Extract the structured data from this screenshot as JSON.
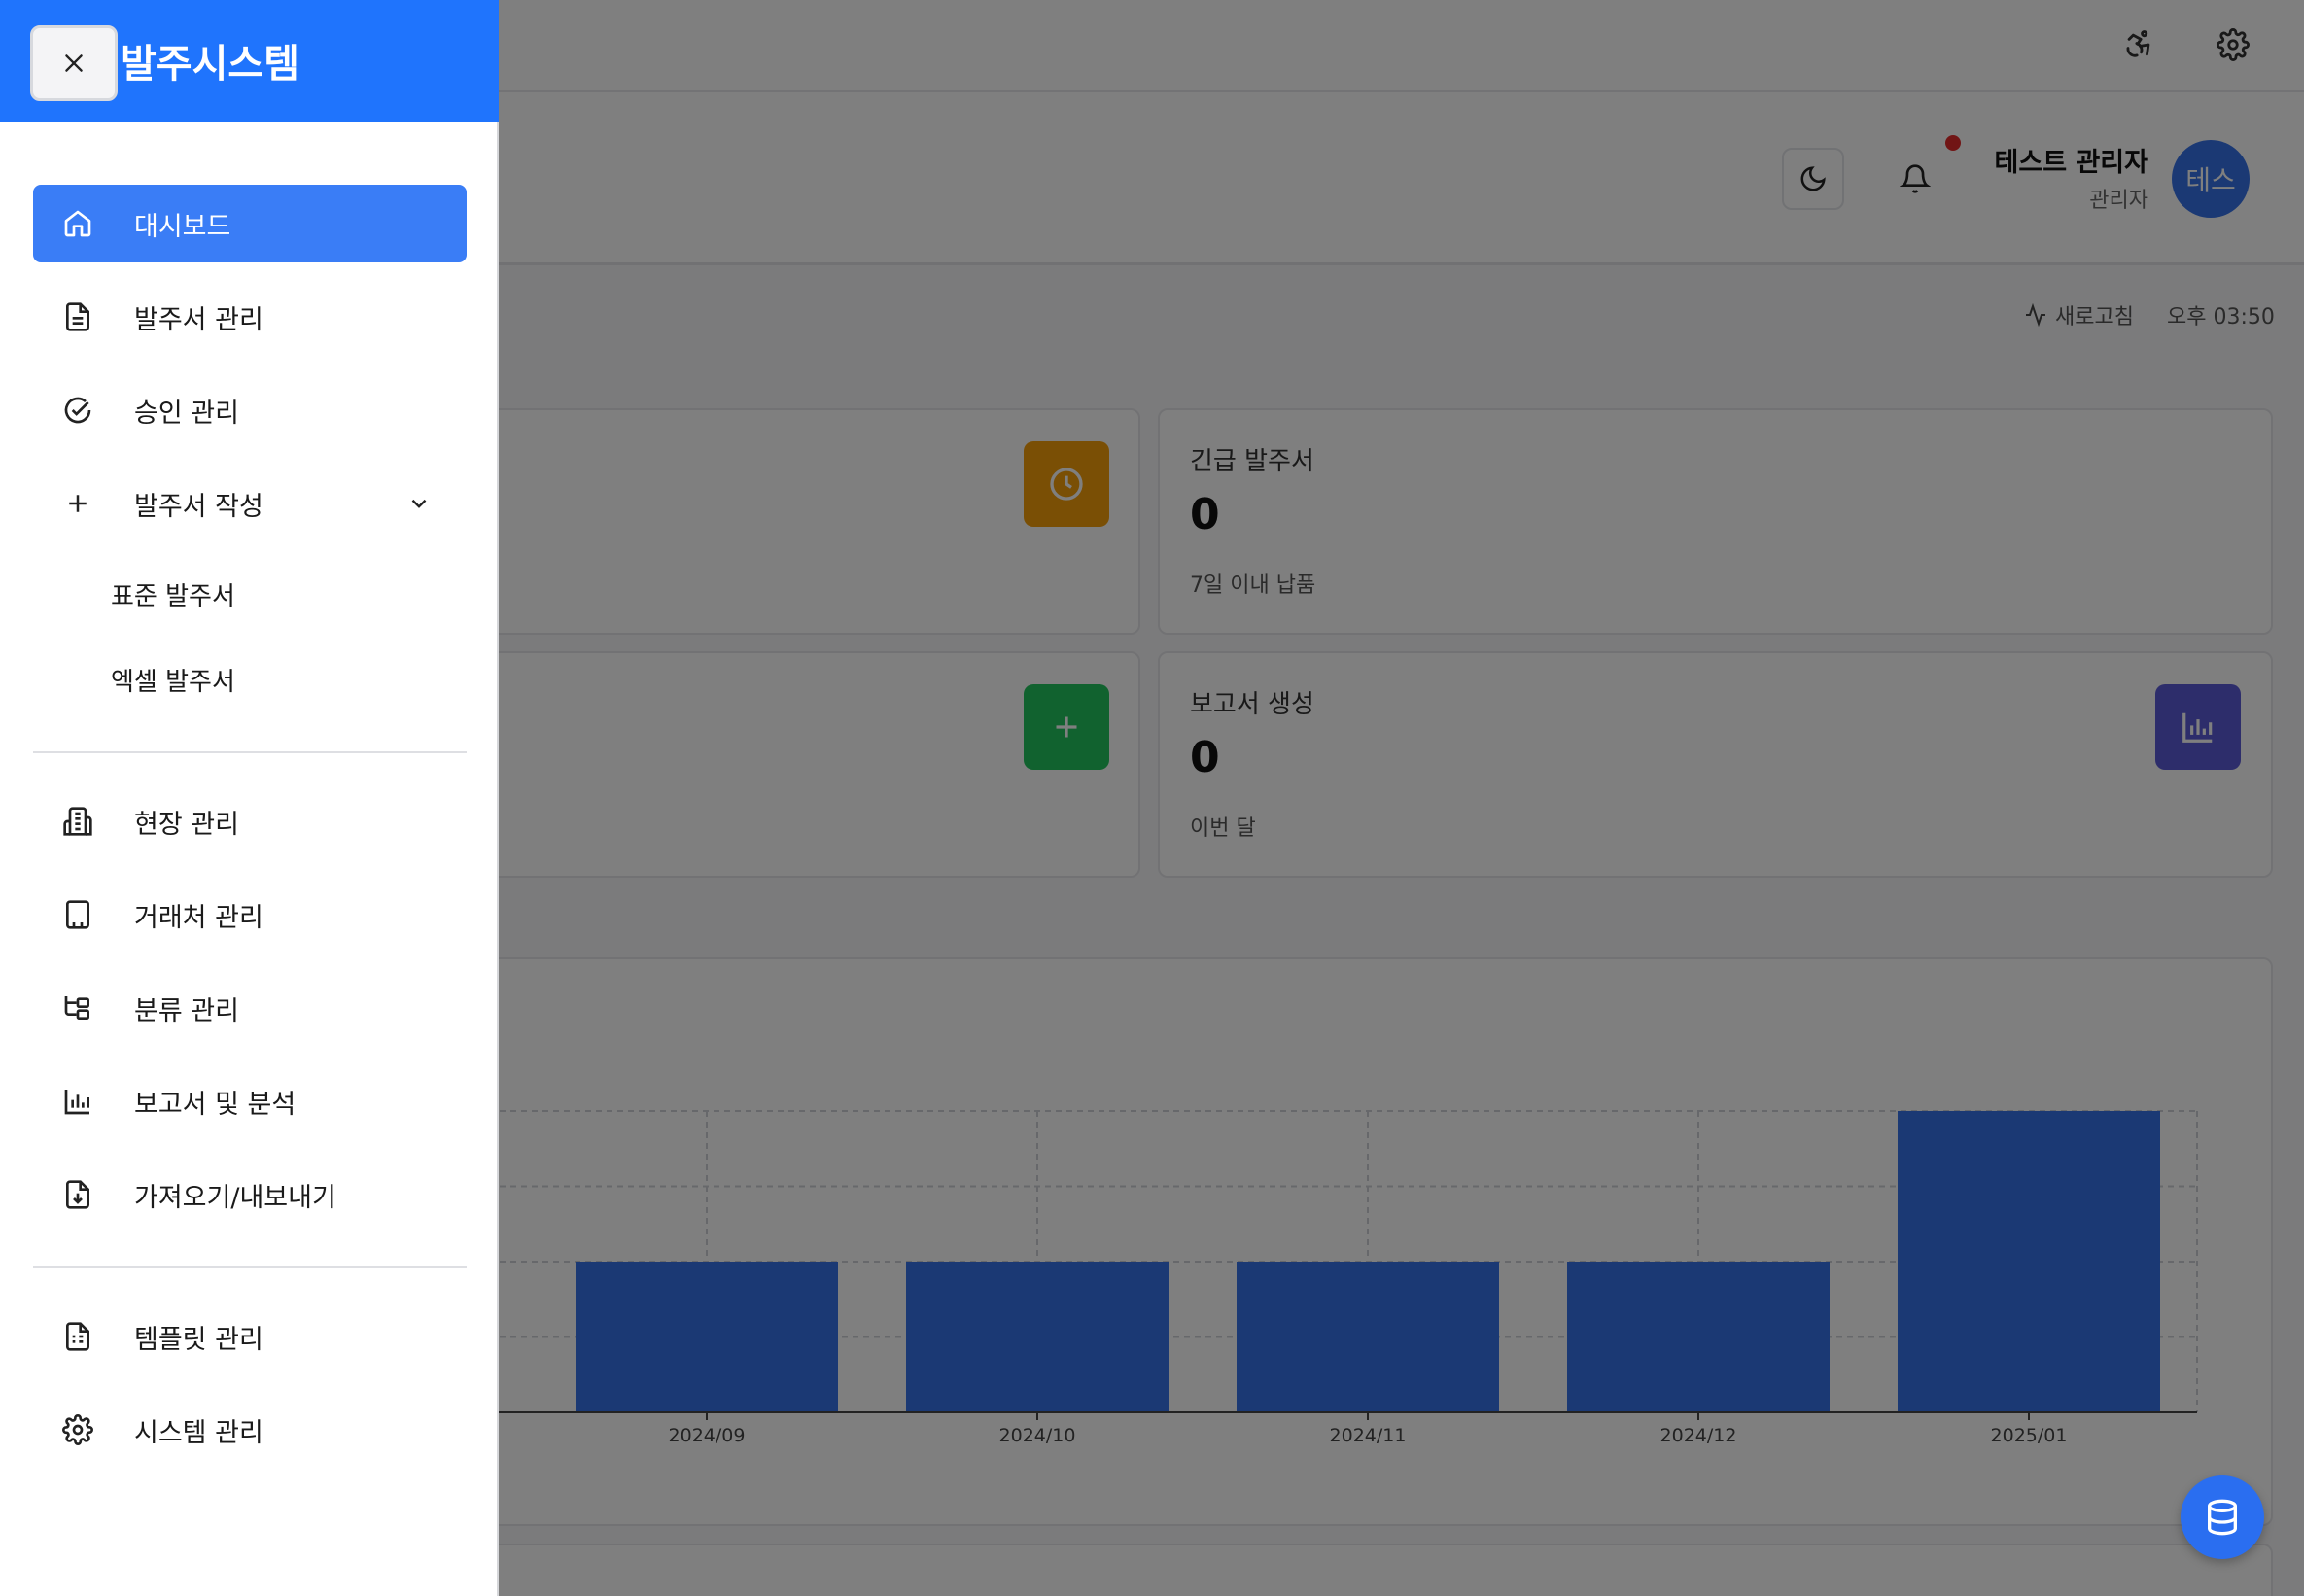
{
  "drawer": {
    "title": "발주시스템",
    "items": [
      {
        "label": "대시보드",
        "icon": "home-icon"
      },
      {
        "label": "발주서 관리",
        "icon": "document-icon"
      },
      {
        "label": "승인 관리",
        "icon": "check-circle-icon"
      },
      {
        "label": "발주서 작성",
        "icon": "plus-icon"
      },
      {
        "label": "현장 관리",
        "icon": "buildings-icon"
      },
      {
        "label": "거래처 관리",
        "icon": "office-building-icon"
      },
      {
        "label": "분류 관리",
        "icon": "tree-structure-icon"
      },
      {
        "label": "보고서 및 분석",
        "icon": "bar-chart-icon"
      },
      {
        "label": "가져오기/내보내기",
        "icon": "file-download-icon"
      },
      {
        "label": "템플릿 관리",
        "icon": "template-icon"
      },
      {
        "label": "시스템 관리",
        "icon": "gear-icon"
      }
    ],
    "sub_items": [
      "표준 발주서",
      "엑셀 발주서"
    ]
  },
  "header": {
    "user_name": "테스트 관리자",
    "user_role": "관리자",
    "avatar_text": "테스",
    "refresh_label": "새로고침",
    "time": "오후 03:50"
  },
  "cards": [
    {
      "title": "긴급 발주서",
      "value": "0",
      "sub": "7일 이내 납품",
      "icon": "clock-icon"
    },
    {
      "title": "보고서 생성",
      "value": "0",
      "sub": "이번 달",
      "icon": "bar-chart-icon"
    }
  ],
  "colors": {
    "primary": "#1f74fd",
    "active_item": "#3a7df6",
    "bar": "#3672e8",
    "amber": "#f59e0b",
    "green": "#22c55e",
    "indigo": "#5b5bd6"
  },
  "chart_data": {
    "type": "bar",
    "categories": [
      "2024/09",
      "2024/10",
      "2024/11",
      "2024/12",
      "2025/01"
    ],
    "values": [
      2,
      2,
      2,
      2,
      4
    ],
    "ylim": [
      0,
      4
    ],
    "grid": true
  }
}
